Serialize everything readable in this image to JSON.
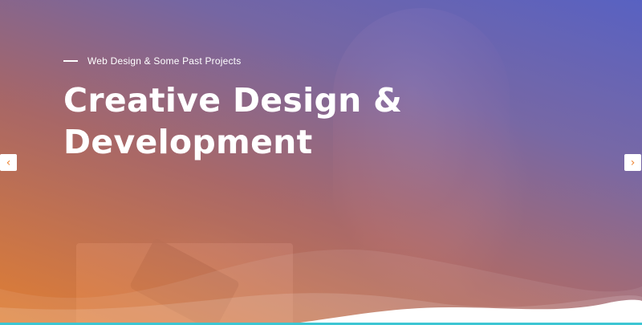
{
  "hero": {
    "subtitle": "Web Design & Some Past Projects",
    "title_line1": "Creative Design &",
    "title_line2": "Development"
  },
  "slider": {
    "prev_glyph": "‹",
    "next_glyph": "›"
  },
  "colors": {
    "accent_orange": "#ee8534",
    "accent_blue": "#5863cc",
    "bottom_bar": "#3cc6d3",
    "text": "#ffffff"
  },
  "icons": {
    "prev": "chevron-left-icon",
    "next": "chevron-right-icon"
  }
}
